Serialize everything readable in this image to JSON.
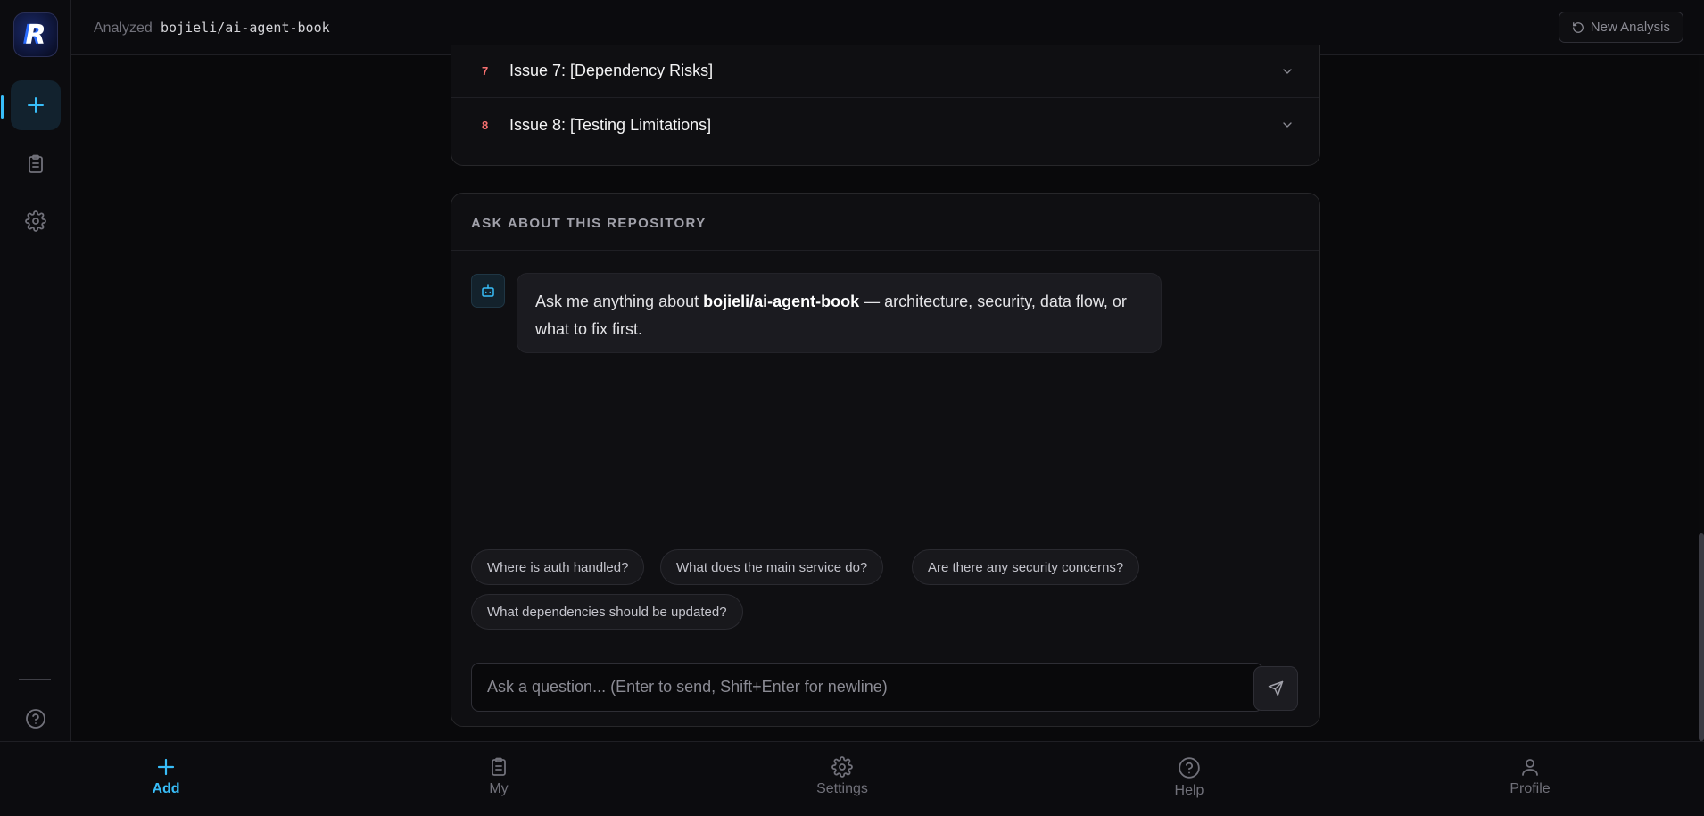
{
  "topbar": {
    "label": "Analyzed",
    "repo": "bojieli/ai-agent-book",
    "new_analysis": "New Analysis"
  },
  "sidebar": {
    "logo_letter": "R",
    "items": [
      {
        "name": "add",
        "icon": "plus-icon",
        "active": true
      },
      {
        "name": "my",
        "icon": "clipboard-icon",
        "active": false
      },
      {
        "name": "settings",
        "icon": "gear-icon",
        "active": false
      },
      {
        "name": "help",
        "icon": "help-circle-icon",
        "active": false
      }
    ]
  },
  "issues": [
    {
      "num": "7",
      "title": "Issue 7: [Dependency Risks]"
    },
    {
      "num": "8",
      "title": "Issue 8: [Testing Limitations]"
    }
  ],
  "ask": {
    "title": "ASK ABOUT THIS REPOSITORY",
    "message_prefix": "Ask me anything about ",
    "message_repo": "bojieli/ai-agent-book",
    "message_suffix": " — architecture, security, data flow, or what to fix first.",
    "suggestions": [
      "Where is auth handled?",
      "What does the main service do?",
      "Are there any security concerns?",
      "What dependencies should be updated?"
    ],
    "input_placeholder": "Ask a question... (Enter to send, Shift+Enter for newline)"
  },
  "bottom_nav": [
    {
      "label": "Add",
      "icon": "plus-icon",
      "active": true
    },
    {
      "label": "My",
      "icon": "clipboard-icon",
      "active": false
    },
    {
      "label": "Settings",
      "icon": "gear-icon",
      "active": false
    },
    {
      "label": "Help",
      "icon": "help-circle-icon",
      "active": false
    },
    {
      "label": "Profile",
      "icon": "user-icon",
      "active": false
    }
  ],
  "colors": {
    "accent": "#38bdf8",
    "issue_number": "#f87171",
    "background": "#09090b"
  }
}
